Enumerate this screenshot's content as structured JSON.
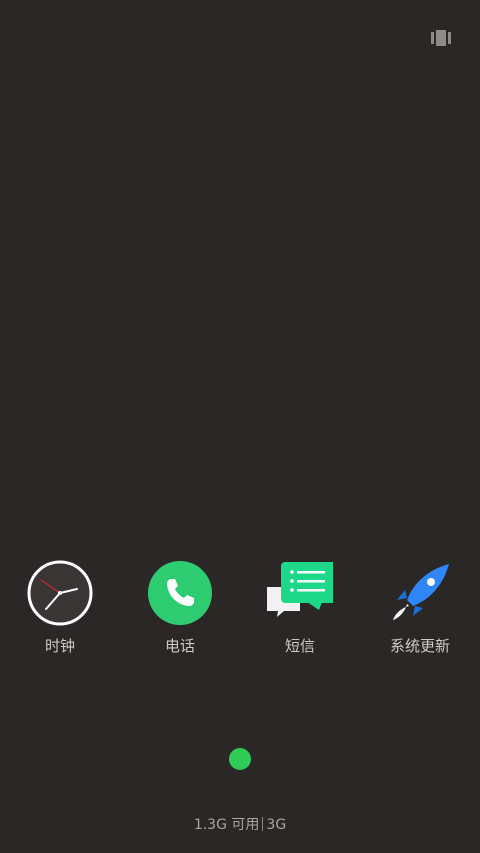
{
  "top_bar": {
    "icon": "layout-toggle-icon"
  },
  "dock": {
    "apps": [
      {
        "label": "时钟",
        "icon": "clock-icon",
        "accent": "#ffffff"
      },
      {
        "label": "电话",
        "icon": "phone-icon",
        "accent": "#2ecc71"
      },
      {
        "label": "短信",
        "icon": "message-icon",
        "accent": "#1ed88a"
      },
      {
        "label": "系统更新",
        "icon": "rocket-icon",
        "accent": "#2f86f6"
      }
    ]
  },
  "pager": {
    "current_page": 1,
    "total_pages": 1,
    "color": "#2ecc55"
  },
  "memory": {
    "available": "1.3G 可用",
    "total": "3G"
  }
}
